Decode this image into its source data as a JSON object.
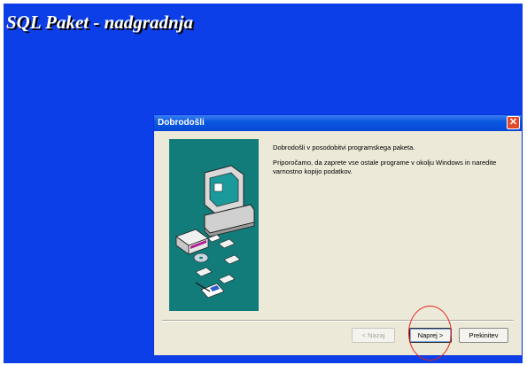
{
  "installer": {
    "title": "SQL Paket - nadgradnja"
  },
  "dialog": {
    "title": "Dobrodošli",
    "close_glyph": "✕",
    "paragraphs": [
      "Dobrodošli v posodobitvi programskega paketa.",
      "Priporočamo, da zaprete vse ostale programe v okolju Windows in naredite varnostno kopijo podatkov."
    ],
    "buttons": {
      "back": "< Nazaj",
      "next": "Naprej >",
      "cancel": "Prekinitev"
    },
    "button_states": {
      "back_enabled": false,
      "next_default": true
    }
  },
  "annotation": {
    "type": "red-circle-highlight",
    "target": "next-button",
    "color": "#e6201d"
  },
  "colors": {
    "desktop": "#0d3fe8",
    "titlebar": "#0548d6",
    "dialog_bg": "#ece9d8",
    "art_panel": "#127c7b"
  },
  "icons": [
    "close-icon",
    "computer-setup-illustration",
    "cd-icon",
    "floppy-disk-icon",
    "box-icon"
  ]
}
